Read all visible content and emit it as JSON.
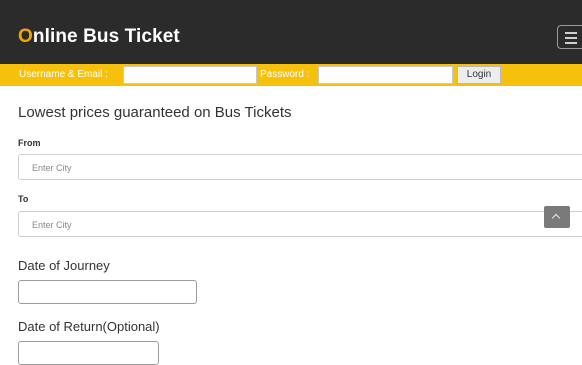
{
  "header": {
    "brand_first": "O",
    "brand_rest": "nline Bus Ticket"
  },
  "login": {
    "username_label": "Username & Email :",
    "password_label": "Password :",
    "username_value": "",
    "password_value": "",
    "login_button": "Login"
  },
  "main": {
    "headline": "Lowest prices guaranteed on Bus Tickets",
    "from_label": "From",
    "from_placeholder": "Enter City",
    "to_label": "To",
    "to_placeholder": "Enter City",
    "date_journey_label": "Date of Journey",
    "date_journey_value": "",
    "date_return_label": "Date of Return(Optional)",
    "date_return_value": ""
  },
  "colors": {
    "header_bg": "#2b2b2b",
    "brand_accent": "#f2a600",
    "login_bar_bg": "#f6c10d"
  },
  "icons": {
    "menu": "hamburger-menu-icon",
    "scroll_up": "chevron-up-icon"
  }
}
